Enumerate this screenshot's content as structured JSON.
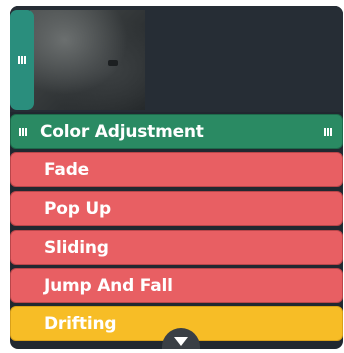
{
  "track": {
    "handle_icon": "grip-icon"
  },
  "color_adjustment": {
    "label": "Color Adjustment",
    "color": "#2a8a63"
  },
  "effects": [
    {
      "label": "Fade",
      "color": "#e85f63"
    },
    {
      "label": "Pop Up",
      "color": "#e85f63"
    },
    {
      "label": "Sliding",
      "color": "#e85f63"
    },
    {
      "label": "Jump And Fall",
      "color": "#e85f63"
    },
    {
      "label": "Drifting",
      "color": "#f7bd26"
    }
  ],
  "scroll": {
    "icon": "triangle-down-icon"
  }
}
